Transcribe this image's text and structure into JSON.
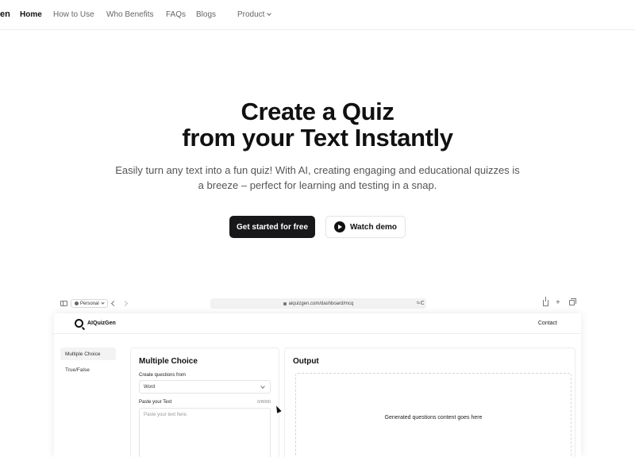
{
  "nav": {
    "brand_fragment": "en",
    "items": [
      {
        "label": "Home",
        "active": true
      },
      {
        "label": "How to Use",
        "active": false
      },
      {
        "label": "Who Benefits",
        "active": false
      },
      {
        "label": "FAQs",
        "active": false
      },
      {
        "label": "Blogs",
        "active": false
      },
      {
        "label": "Product",
        "active": false
      }
    ]
  },
  "hero": {
    "title_line1": "Create a Quiz",
    "title_line2": "from your Text Instantly",
    "subtitle_line1": "Easily turn any text into a fun quiz! With AI, creating engaging and educational quizzes is",
    "subtitle_line2": "a breeze – perfect for learning and testing in a snap.",
    "cta_primary": "Get started for free",
    "cta_secondary": "Watch demo"
  },
  "browser": {
    "profile": "Personal",
    "url": "aiquizgen.com/dashboard/mcq"
  },
  "app": {
    "brand": "AIQuizGen",
    "contact": "Contact",
    "sidebar": [
      {
        "label": "Multiple Choice",
        "active": true
      },
      {
        "label": "True/False",
        "active": false
      }
    ],
    "form": {
      "title": "Multiple Choice",
      "create_from_label": "Create questions from",
      "create_from_value": "Word",
      "paste_label": "Paste your Text",
      "char_count": "0/8000",
      "textarea_placeholder": "Paste your text here."
    },
    "output": {
      "title": "Output",
      "placeholder": "Generated questions content goes here"
    }
  },
  "colors": {
    "primary_button": "#18181b",
    "text_main": "#111111",
    "text_muted": "#555555"
  }
}
